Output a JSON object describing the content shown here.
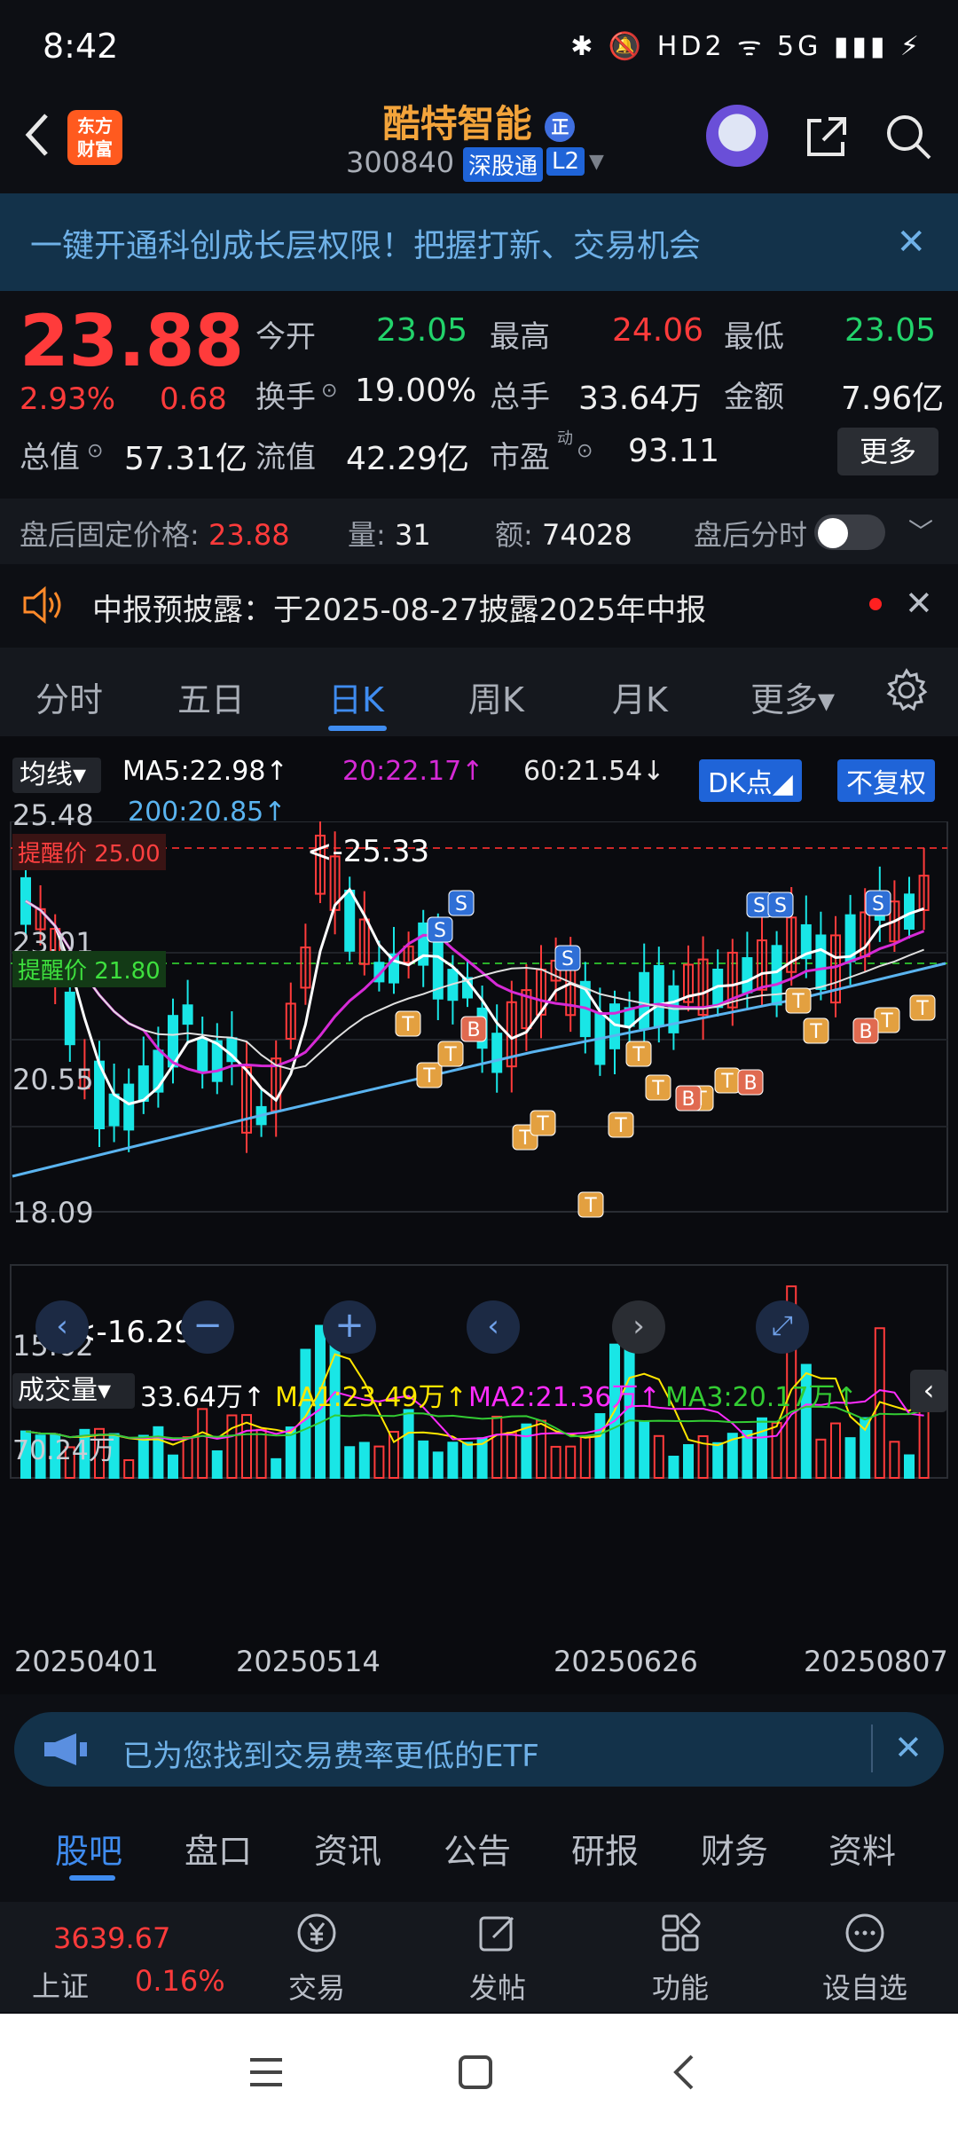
{
  "status": {
    "time": "8:42",
    "icons": "✱ 🔕 HD2 ᯤ 5G ▮▮▮ ⚡"
  },
  "header": {
    "logo_text": "东方\n财富",
    "stock_name": "酷特智能",
    "badge": "正",
    "stock_code": "300840",
    "tag_market": "深股通",
    "tag_level": "L2"
  },
  "banner": {
    "text": "一键开通科创成长层权限！把握打新、交易机会",
    "close": "✕"
  },
  "quote": {
    "price": "23.88",
    "pct": "2.93%",
    "chg": "0.68",
    "open_label": "今开",
    "open": "23.05",
    "high_label": "最高",
    "high": "24.06",
    "low_label": "最低",
    "low": "23.05",
    "turnover_label": "换手",
    "turnover": "19.00%",
    "volume_label": "总手",
    "volume": "33.64万",
    "amount_label": "金额",
    "amount": "7.96亿",
    "mcap_label": "总值",
    "mcap": "57.31亿",
    "float_label": "流值",
    "float": "42.29亿",
    "pe_label": "市盈",
    "pe_sup": "动",
    "pe": "93.11",
    "more": "更多"
  },
  "afterhours": {
    "price_label": "盘后固定价格:",
    "price": "23.88",
    "vol_label": "量:",
    "vol": "31",
    "amt_label": "额:",
    "amt": "74028",
    "switch_label": "盘后分时"
  },
  "notice": {
    "text": "中报预披露：于2025-08-27披露2025年中报"
  },
  "chart_tabs": [
    "分时",
    "五日",
    "日K",
    "周K",
    "月K",
    "更多▾"
  ],
  "chart": {
    "ma_selector": "均线▾",
    "ma5": "MA5:22.98↑",
    "ma20": "20:22.17↑",
    "ma60": "60:21.54↓",
    "ma200": "200:20.85↑",
    "dk_button": "DK点◢",
    "fq_button": "不复权",
    "y_labels": [
      "25.48",
      "23.01",
      "20.55",
      "18.09",
      "15.62"
    ],
    "alert_upper": "提醒价 25.00",
    "alert_lower": "提醒价 21.80",
    "max_label": "<-25.33",
    "min_label": "<-16.29",
    "vol_selector": "成交量▾",
    "vol_value": "33.64万↑",
    "vma1": "MA1:23.49万↑",
    "vma2": "MA2:21.36万↑",
    "vma3": "MA3:20.17万↑",
    "vol_max": "70.24万",
    "dates": [
      "20250401",
      "20250514",
      "20250626",
      "20250807"
    ],
    "colors": {
      "up": "#ff3b3b",
      "down": "#19e6e6",
      "ma5": "#ffffff",
      "ma20": "#d62ad6",
      "ma200": "#5ab4f0",
      "vma1": "#ffe600",
      "vma2": "#ff2cff",
      "vma3": "#33cc33"
    }
  },
  "etf": {
    "text": "已为您找到交易费率更低的ETF"
  },
  "bottom_tabs": [
    "股吧",
    "盘口",
    "资讯",
    "公告",
    "研报",
    "财务",
    "资料"
  ],
  "toolbar": {
    "index_value": "3639.67",
    "index_name": "上证",
    "index_pct": "0.16%",
    "trade": "交易",
    "post": "发帖",
    "func": "功能",
    "watch": "设自选"
  }
}
